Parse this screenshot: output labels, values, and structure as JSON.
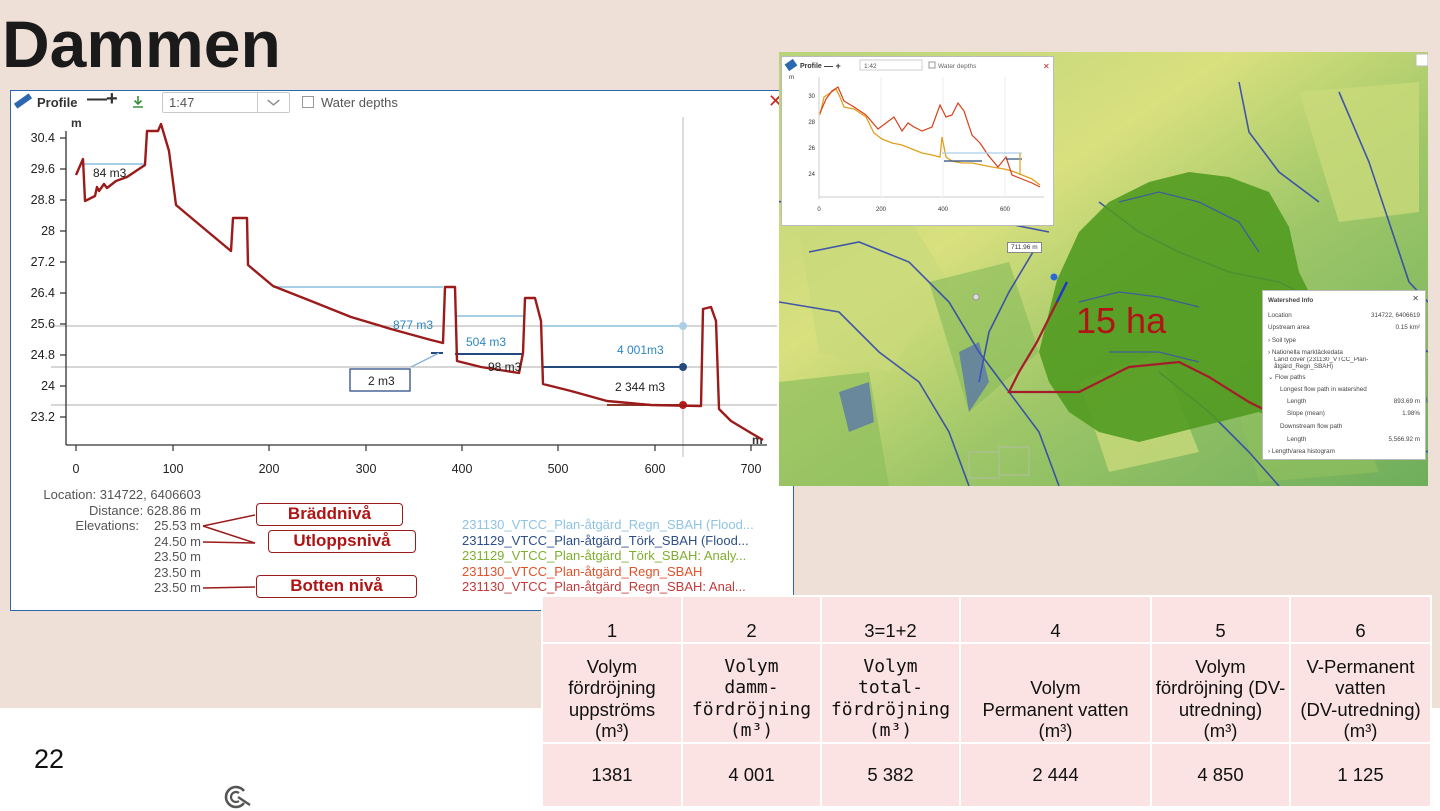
{
  "slide": {
    "title": "Dammen",
    "page_number": "22"
  },
  "profile_panel": {
    "title": "Profile",
    "zoom_minus": "—",
    "zoom_plus": "+",
    "scale_value": "1:47",
    "water_depths_label": "Water depths",
    "close_symbol": "✕",
    "y_axis_unit": "m",
    "x_axis_unit": "m",
    "y_ticks": [
      "30.4",
      "29.6",
      "28.8",
      "28",
      "27.2",
      "26.4",
      "25.6",
      "24.8",
      "24",
      "23.2"
    ],
    "x_ticks": [
      "0",
      "100",
      "200",
      "300",
      "400",
      "500",
      "600",
      "700"
    ],
    "volume_labels": {
      "v84": "84 m3",
      "v877": "877 m3",
      "v504": "504 m3",
      "v98": "98 m3",
      "v2": "2 m3",
      "v4001": "4 001m3",
      "v2344": "2 344 m3"
    },
    "info": {
      "location": "Location: 314722, 6406603",
      "distance": "Distance: 628.86 m",
      "elevations_label": "Elevations:",
      "elevations": [
        "25.53 m",
        "24.50 m",
        "23.50 m",
        "23.50 m",
        "23.50 m"
      ]
    },
    "callouts": {
      "braddniva": "Bräddnivå",
      "utloppsniva": "Utloppsnivå",
      "bottenniva": "Botten nivå"
    },
    "layers": [
      {
        "name": "231130_VTCC_Plan-åtgärd_Regn_SBAH (Flood...",
        "color": "#8fc3e3"
      },
      {
        "name": "231129_VTCC_Plan-åtgärd_Törk_SBAH (Flood...",
        "color": "#2d4f86"
      },
      {
        "name": "231129_VTCC_Plan-åtgärd_Törk_SBAH: Analy...",
        "color": "#7fae2e"
      },
      {
        "name": "231130_VTCC_Plan-åtgärd_Regn_SBAH",
        "color": "#e0522a"
      },
      {
        "name": "231130_VTCC_Plan-åtgärd_Regn_SBAH: Anal...",
        "color": "#c23a3a"
      }
    ],
    "colors": {
      "terrain": "#9b1b1b",
      "light_level": "#a9cfe6",
      "dark_level": "#24497d",
      "grid": "#bdbdbd"
    }
  },
  "map": {
    "area_label": "15 ha",
    "distance_tag": "711.96 m",
    "inset": {
      "title": "Profile",
      "scale_value": "1:42",
      "water_depths_label": "Water depths",
      "close_symbol": "✕",
      "y_unit": "m",
      "y_ticks": [
        "30",
        "28",
        "26",
        "24"
      ],
      "x_ticks": [
        "0",
        "200",
        "400",
        "600"
      ]
    },
    "watershed": {
      "title": "Watershed Info",
      "close_symbol": "✕",
      "location_label": "Location",
      "location_value": "314722, 6406619",
      "upstream_label": "Upstream area",
      "upstream_value": "0.15 km²",
      "soil_type": "Soil type",
      "land_cover_group": "Nationella marktäckedata",
      "land_cover_label": "Land cover (231130_VTCC_Plan-åtgärd_Regn_SBAH)",
      "flow_paths": "Flow paths",
      "longest_header": "Longest flow path in watershed",
      "length_label": "Length",
      "length_value": "893.69 m",
      "slope_label": "Slope (mean)",
      "slope_value": "1.98%",
      "downstream_header": "Downstream flow path",
      "down_length_label": "Length",
      "down_length_value": "5,566.92 m",
      "histogram": "Length/area histogram"
    }
  },
  "volume_table": {
    "columns": [
      {
        "num": "1",
        "header": [
          "Volym",
          "fördröjning",
          "uppströms",
          "(m³)"
        ],
        "value": "1381"
      },
      {
        "num": "2",
        "header": [
          "Volym",
          "damm-",
          "fördröjning",
          "(m³)"
        ],
        "value": "4 001"
      },
      {
        "num": "3=1+2",
        "header": [
          "Volym",
          "total-",
          "fördröjning",
          "(m³)"
        ],
        "value": "5 382"
      },
      {
        "num": "4",
        "header": [
          "Volym",
          "Permanent vatten",
          "(m³)"
        ],
        "value": "2 444"
      },
      {
        "num": "5",
        "header": [
          "Volym",
          "fördröjning (DV-",
          "utredning)",
          "(m³)"
        ],
        "value": "4 850"
      },
      {
        "num": "6",
        "header": [
          "V-Permanent",
          "vatten",
          "(DV-utredning)",
          "(m³)"
        ],
        "value": "1 125"
      }
    ]
  }
}
